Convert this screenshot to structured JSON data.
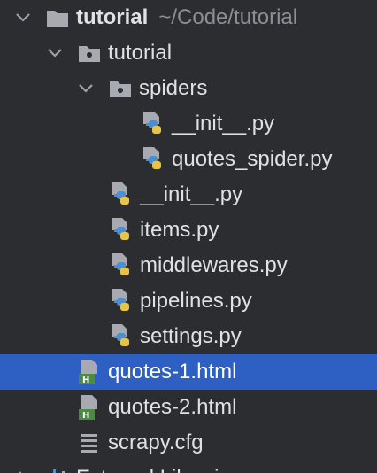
{
  "tree": {
    "root": {
      "label": "tutorial",
      "path": "~/Code/tutorial"
    },
    "package": {
      "label": "tutorial"
    },
    "spiders": {
      "label": "spiders"
    },
    "files": [
      {
        "label": "__init__.py",
        "icon": "python-file-icon"
      },
      {
        "label": "quotes_spider.py",
        "icon": "python-file-icon"
      },
      {
        "label": "__init__.py",
        "icon": "python-file-icon"
      },
      {
        "label": "items.py",
        "icon": "python-file-icon"
      },
      {
        "label": "middlewares.py",
        "icon": "python-file-icon"
      },
      {
        "label": "pipelines.py",
        "icon": "python-file-icon"
      },
      {
        "label": "settings.py",
        "icon": "python-file-icon"
      },
      {
        "label": "quotes-1.html",
        "icon": "html-file-icon",
        "selected": true
      },
      {
        "label": "quotes-2.html",
        "icon": "html-file-icon"
      },
      {
        "label": "scrapy.cfg",
        "icon": "config-file-icon"
      }
    ],
    "partial_row": {
      "label": "External Libraries"
    }
  },
  "colors": {
    "background": "#2b2d30",
    "selection": "#2e5fc2",
    "text": "#dfe1e5",
    "muted": "#8c8f94"
  }
}
